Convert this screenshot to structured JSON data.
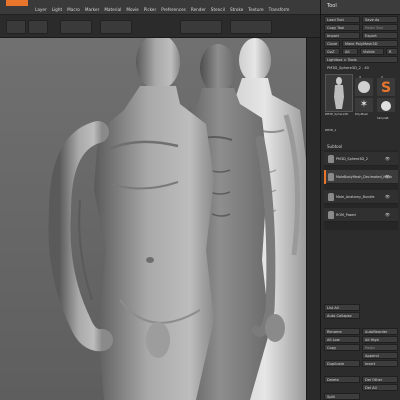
{
  "menubar": {
    "items": [
      "Layer",
      "Light",
      "Macro",
      "Marker",
      "Material",
      "Movie",
      "Picker",
      "Preferences",
      "Render",
      "Stencil",
      "Stroke",
      "Texture",
      "Transform"
    ]
  },
  "tool_panel": {
    "tab_label": "Tool",
    "buttons": {
      "load_tool": "Load Tool",
      "save_as": "Save As",
      "copy_tool": "Copy Tool",
      "paste_tool": "Paste Tool",
      "import": "Import",
      "export": "Export",
      "clone": "Clone",
      "make_polymesh": "Make PolyMesh3D",
      "goz": "GoZ",
      "all": "All",
      "visible": "Visible",
      "r": "R"
    },
    "lightbox_label": "Lightbox > Tools",
    "current_tool_name": "PM3D_Sphere3D_2 . 40",
    "thumb_numbers": [
      "3",
      "2"
    ],
    "thumb_labels": [
      "PM3D_Sphere3D",
      "PolyMesh",
      "SimpleB",
      "PM3D_1"
    ],
    "subtool": {
      "header": "Subtool",
      "rows": [
        {
          "name": "PM3D_Sphere3D_2",
          "active": false
        },
        {
          "name": "MaleBodyMesh_Decimated_Mesh",
          "active": true
        },
        {
          "name": "Male_Anatomy_Bundle",
          "active": false
        },
        {
          "name": "ROM_Posed",
          "active": false
        }
      ]
    },
    "lower_buttons": {
      "list_all": "List All",
      "auto_collapse": "Auto Collapse",
      "rename": "Rename",
      "auto_reorder": "AutoReorder",
      "all_low": "All Low",
      "all_high": "All High",
      "copy": "Copy",
      "paste": "Paste",
      "append": "Append",
      "duplicate": "Duplicate",
      "insert": "Insert",
      "delete": "Delete",
      "del_other": "Del Other",
      "del_all": "Del All",
      "split": "Split"
    }
  },
  "colors": {
    "accent": "#e8752b",
    "viewport_bg": "#6e6e6e",
    "panel_bg": "#2c2c2c"
  }
}
